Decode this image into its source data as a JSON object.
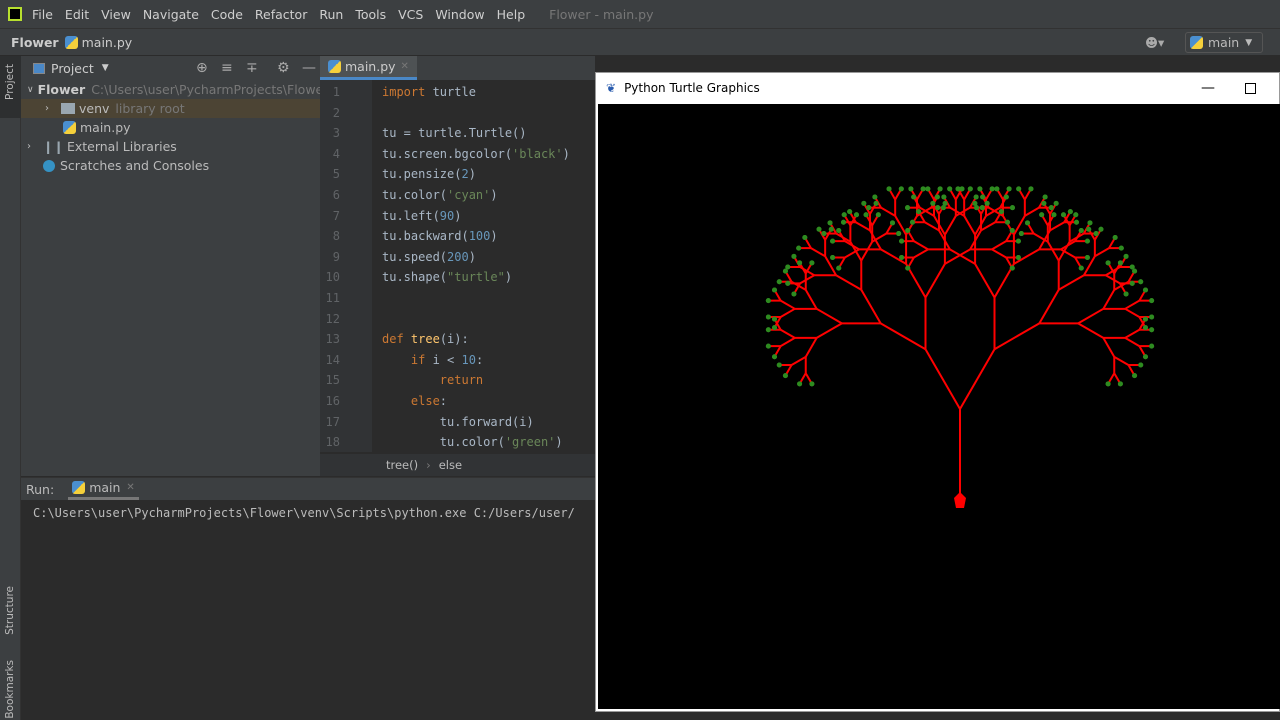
{
  "menubar": {
    "items": [
      "File",
      "Edit",
      "View",
      "Navigate",
      "Code",
      "Refactor",
      "Run",
      "Tools",
      "VCS",
      "Window",
      "Help"
    ],
    "window_title": "Flower - main.py"
  },
  "navbar": {
    "project": "Flower",
    "file": "main.py",
    "run_config": "main"
  },
  "side_tabs": {
    "project": "Project",
    "structure": "Structure",
    "bookmarks": "Bookmarks"
  },
  "project_panel": {
    "title": "Project",
    "root": "Flower",
    "root_path": "C:\\Users\\user\\PycharmProjects\\Flower",
    "venv": "venv",
    "venv_note": "library root",
    "file": "main.py",
    "ext_libs": "External Libraries",
    "scratches": "Scratches and Consoles"
  },
  "editor": {
    "tab": "main.py",
    "breadcrumb": [
      "tree()",
      "else"
    ],
    "lines": [
      [
        [
          "kw",
          "import"
        ],
        [
          "tx",
          " turtle"
        ]
      ],
      [],
      [
        [
          "tx",
          "tu = turtle.Turtle()"
        ]
      ],
      [
        [
          "tx",
          "tu.screen.bgcolor("
        ],
        [
          "str",
          "'black'"
        ],
        [
          "tx",
          ")"
        ]
      ],
      [
        [
          "tx",
          "tu.pensize("
        ],
        [
          "num",
          "2"
        ],
        [
          "tx",
          ")"
        ]
      ],
      [
        [
          "tx",
          "tu.color("
        ],
        [
          "str",
          "'cyan'"
        ],
        [
          "tx",
          ")"
        ]
      ],
      [
        [
          "tx",
          "tu.left("
        ],
        [
          "num",
          "90"
        ],
        [
          "tx",
          ")"
        ]
      ],
      [
        [
          "tx",
          "tu.backward("
        ],
        [
          "num",
          "100"
        ],
        [
          "tx",
          ")"
        ]
      ],
      [
        [
          "tx",
          "tu.speed("
        ],
        [
          "num",
          "200"
        ],
        [
          "tx",
          ")"
        ]
      ],
      [
        [
          "tx",
          "tu.shape("
        ],
        [
          "str",
          "\"turtle\""
        ],
        [
          "tx",
          ")"
        ]
      ],
      [],
      [],
      [
        [
          "kw",
          "def "
        ],
        [
          "fn",
          "tree"
        ],
        [
          "tx",
          "(i):"
        ]
      ],
      [
        [
          "kw",
          "    if"
        ],
        [
          "tx",
          " i < "
        ],
        [
          "num",
          "10"
        ],
        [
          "tx",
          ":"
        ]
      ],
      [
        [
          "kw",
          "        return"
        ]
      ],
      [
        [
          "kw",
          "    else"
        ],
        [
          "tx",
          ":"
        ]
      ],
      [
        [
          "tx",
          "        tu.forward(i)"
        ]
      ],
      [
        [
          "tx",
          "        tu.color("
        ],
        [
          "str",
          "'green'"
        ],
        [
          "tx",
          ")"
        ]
      ]
    ]
  },
  "run_panel": {
    "label": "Run:",
    "tab": "main",
    "output": "C:\\Users\\user\\PycharmProjects\\Flower\\venv\\Scripts\\python.exe C:/Users/user/"
  },
  "turtle_window": {
    "title": "Python Turtle Graphics",
    "branch_color": "#ff0000",
    "leaf_color": "#2e8b20"
  }
}
